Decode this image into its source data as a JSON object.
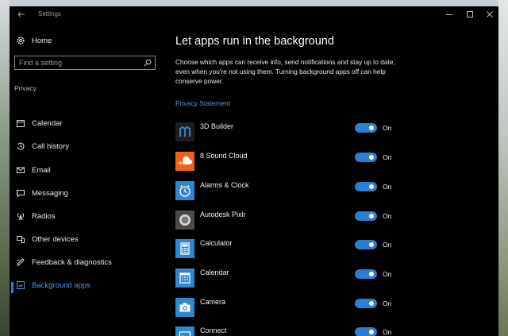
{
  "window": {
    "title": "Settings"
  },
  "sidebar": {
    "home_label": "Home",
    "search_placeholder": "Find a setting",
    "section_label": "Privacy",
    "items": [
      {
        "label": "Calendar",
        "icon": "calendar-icon",
        "selected": false
      },
      {
        "label": "Call history",
        "icon": "call-history-icon",
        "selected": false
      },
      {
        "label": "Email",
        "icon": "email-icon",
        "selected": false
      },
      {
        "label": "Messaging",
        "icon": "messaging-icon",
        "selected": false
      },
      {
        "label": "Radios",
        "icon": "radios-icon",
        "selected": false
      },
      {
        "label": "Other devices",
        "icon": "other-devices-icon",
        "selected": false
      },
      {
        "label": "Feedback & diagnostics",
        "icon": "feedback-icon",
        "selected": false
      },
      {
        "label": "Background apps",
        "icon": "background-apps-icon",
        "selected": true
      }
    ]
  },
  "main": {
    "title": "Let apps run in the background",
    "description": "Choose which apps can receive info, send notifications and stay up to date, even when you're not using them. Turning background apps off can help conserve power.",
    "privacy_link": "Privacy Statement",
    "apps": [
      {
        "name": "3D Builder",
        "state": "On",
        "tile_color": "#1e1e1e",
        "icon": "3d-builder-icon"
      },
      {
        "name": "8 Sound Cloud",
        "state": "On",
        "tile_color": "#f2621d",
        "icon": "soundcloud-icon"
      },
      {
        "name": "Alarms & Clock",
        "state": "On",
        "tile_color": "#2f87d0",
        "icon": "alarm-clock-icon"
      },
      {
        "name": "Autodesk Pixlr",
        "state": "On",
        "tile_color": "#4a4a4a",
        "icon": "pixlr-icon"
      },
      {
        "name": "Calculator",
        "state": "On",
        "tile_color": "#2f87d0",
        "icon": "calculator-icon"
      },
      {
        "name": "Calendar",
        "state": "On",
        "tile_color": "#2f87d0",
        "icon": "calendar-app-icon"
      },
      {
        "name": "Camera",
        "state": "On",
        "tile_color": "#2f87d0",
        "icon": "camera-icon"
      },
      {
        "name": "Connect",
        "state": "On",
        "tile_color": "#2f87d0",
        "icon": "connect-icon"
      }
    ]
  },
  "colors": {
    "accent": "#2d7dd2",
    "link": "#4c9be8",
    "background": "#000000"
  }
}
